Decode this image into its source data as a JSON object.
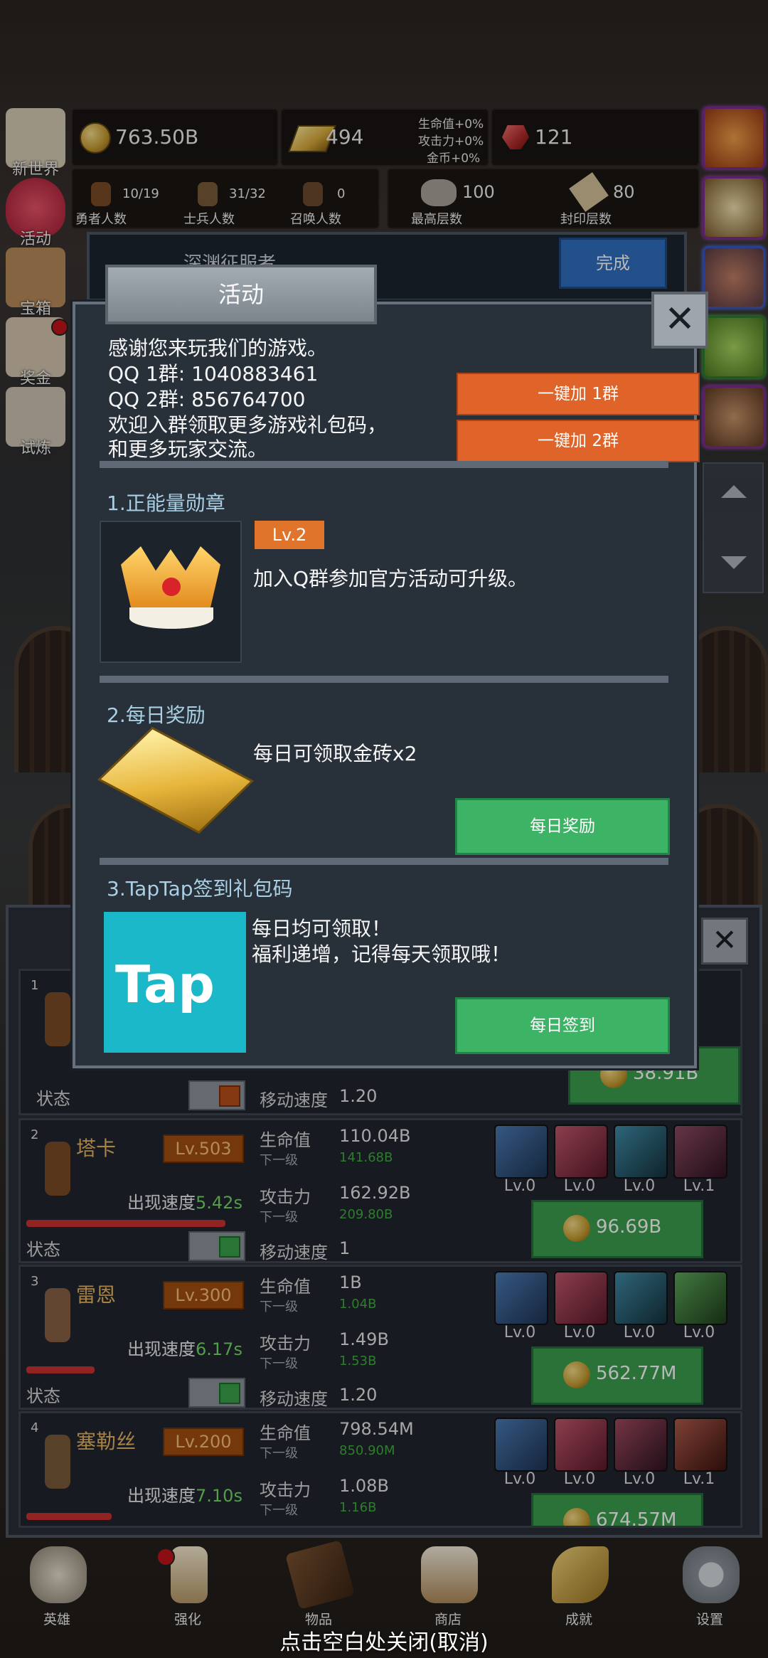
{
  "resources": {
    "coins": "763.50B",
    "gold_bars": "494",
    "bonus_hp": "生命值+0%",
    "bonus_atk": "攻击力+0%",
    "bonus_gold": "金币+0%",
    "gems": "121"
  },
  "counts": [
    {
      "value": "10/19",
      "label": "勇者人数"
    },
    {
      "value": "31/32",
      "label": "士兵人数"
    },
    {
      "value": "0",
      "label": "召唤人数"
    },
    {
      "value": "100",
      "label": "最高层数"
    },
    {
      "value": "80",
      "label": "封印层数"
    }
  ],
  "left_menu": [
    "新世界",
    "活动",
    "宝箱",
    "奖金",
    "试炼"
  ],
  "quest": {
    "title": "深渊征服者",
    "button": "完成"
  },
  "modal": {
    "title": "活动",
    "intro": [
      "感谢您来玩我们的游戏。",
      "QQ 1群: 1040883461",
      "QQ 2群: 856764700",
      "欢迎入群领取更多游戏礼包码，",
      "和更多玩家交流。"
    ],
    "join1": "一键加 1群",
    "join2": "一键加 2群",
    "sec1": {
      "title": "1.正能量勋章",
      "level": "Lv.2",
      "desc": "加入Q群参加官方活动可升级。"
    },
    "sec2": {
      "title": "2.每日奖励",
      "desc": "每日可领取金砖x2",
      "button": "每日奖励"
    },
    "sec3": {
      "title": "3.TapTap签到礼包码",
      "logo": "Tap",
      "desc1": "每日均可领取！",
      "desc2": "福利递增，记得每天领取哦！",
      "button": "每日签到"
    }
  },
  "heroes": [
    {
      "idx": "1",
      "state": "状态",
      "move_label": "移动速度",
      "move": "1.20",
      "cost": "38.91B"
    },
    {
      "idx": "2",
      "name": "塔卡",
      "level": "Lv.503",
      "spawn_label": "出现速度",
      "spawn": "5.42s",
      "hp_label": "生命值",
      "hp": "110.04B",
      "next_label": "下一级",
      "hp_next": "141.68B",
      "atk_label": "攻击力",
      "atk": "162.92B",
      "atk_next": "209.80B",
      "move_label": "移动速度",
      "move": "1",
      "state": "状态",
      "equip": [
        "Lv.0",
        "Lv.0",
        "Lv.0",
        "Lv.1"
      ],
      "cost": "96.69B"
    },
    {
      "idx": "3",
      "name": "雷恩",
      "level": "Lv.300",
      "spawn_label": "出现速度",
      "spawn": "6.17s",
      "hp_label": "生命值",
      "hp": "1B",
      "next_label": "下一级",
      "hp_next": "1.04B",
      "atk_label": "攻击力",
      "atk": "1.49B",
      "atk_next": "1.53B",
      "move_label": "移动速度",
      "move": "1.20",
      "state": "状态",
      "equip": [
        "Lv.0",
        "Lv.0",
        "Lv.0",
        "Lv.0"
      ],
      "cost": "562.77M"
    },
    {
      "idx": "4",
      "name": "塞勒丝",
      "level": "Lv.200",
      "spawn_label": "出现速度",
      "spawn": "7.10s",
      "hp_label": "生命值",
      "hp": "798.54M",
      "next_label": "下一级",
      "hp_next": "850.90M",
      "atk_label": "攻击力",
      "atk": "1.08B",
      "atk_next": "1.16B",
      "equip": [
        "Lv.0",
        "Lv.0",
        "Lv.0",
        "Lv.1"
      ],
      "cost": "674.57M"
    }
  ],
  "nav": [
    "英雄",
    "强化",
    "物品",
    "商店",
    "成就",
    "设置"
  ],
  "footer_hint": "点击空白处关闭(取消)"
}
